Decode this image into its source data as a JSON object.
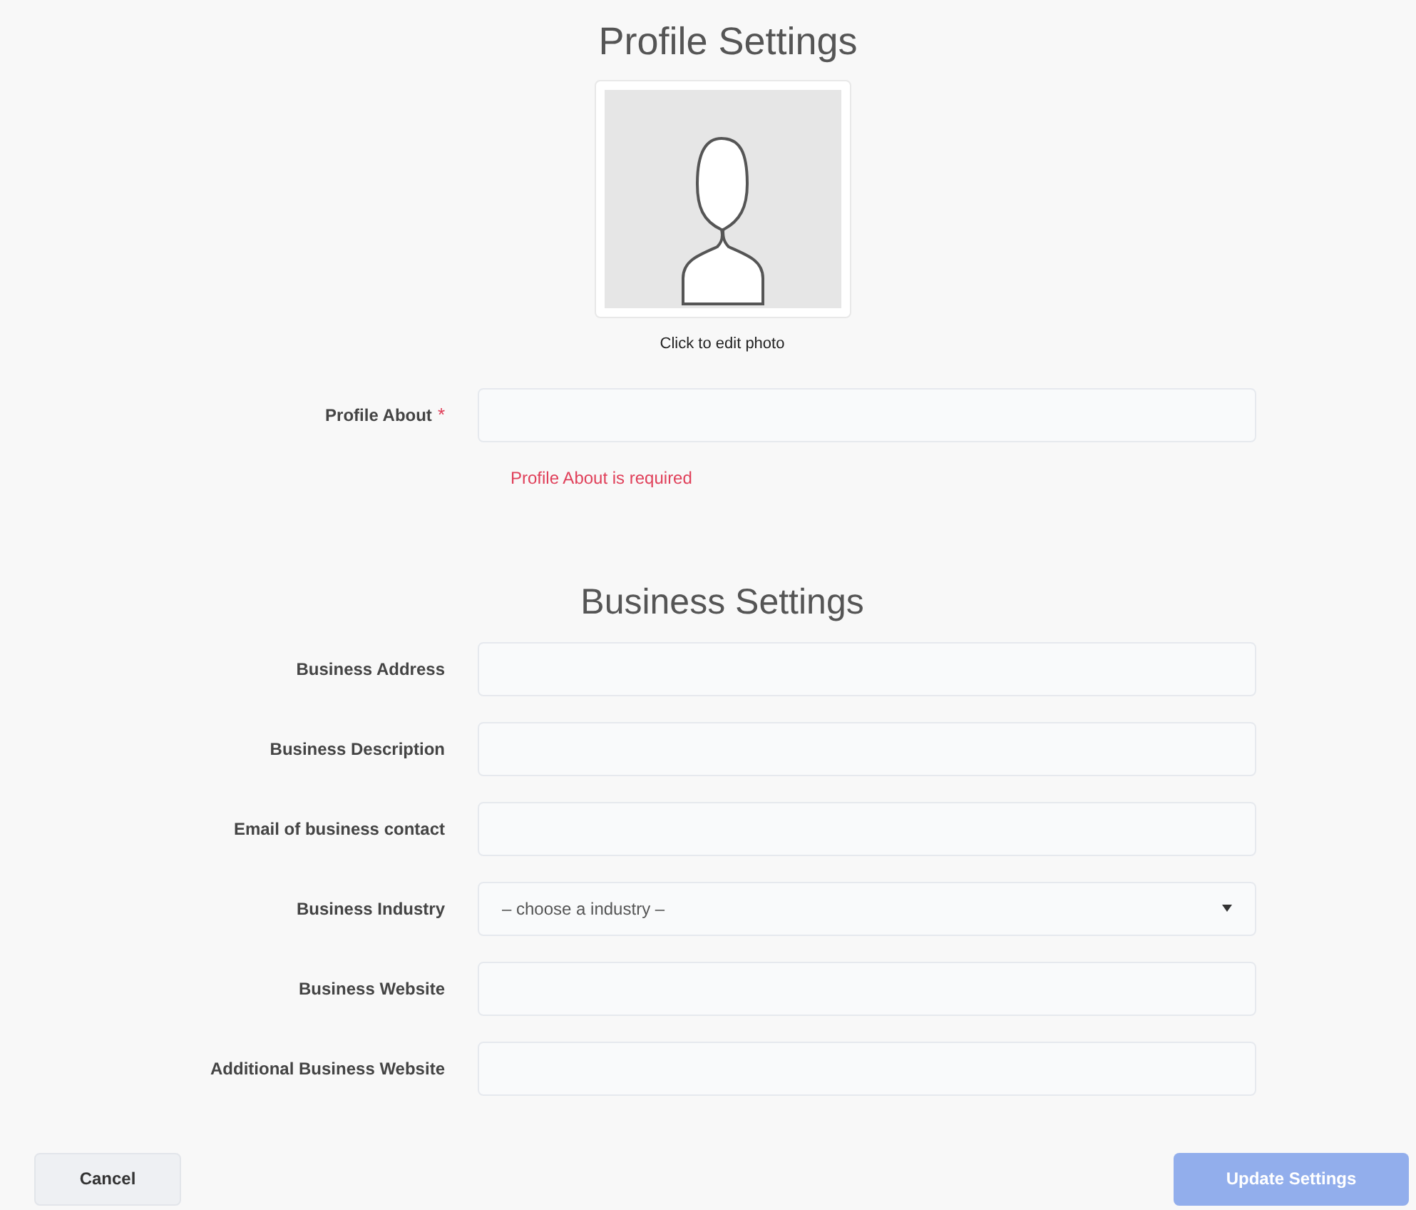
{
  "profile": {
    "title": "Profile Settings",
    "photo_caption": "Click to edit photo",
    "fields": [
      {
        "label": "Profile About",
        "kind": "text",
        "required": true,
        "required_mark": "*",
        "error": "Profile About is required"
      }
    ]
  },
  "business": {
    "title": "Business Settings",
    "fields": [
      {
        "label": "Business Address",
        "kind": "text"
      },
      {
        "label": "Business Description",
        "kind": "text"
      },
      {
        "label": "Email of business contact",
        "kind": "text"
      },
      {
        "label": "Business Industry",
        "kind": "select",
        "value": "– choose a industry –"
      },
      {
        "label": "Business Website",
        "kind": "text"
      },
      {
        "label": "Additional Business Website",
        "kind": "text"
      }
    ]
  },
  "buttons": [
    {
      "label": "Cancel",
      "kind": "secondary",
      "disabled": false
    },
    {
      "label": "Update Settings",
      "kind": "primary",
      "disabled": true
    }
  ]
}
